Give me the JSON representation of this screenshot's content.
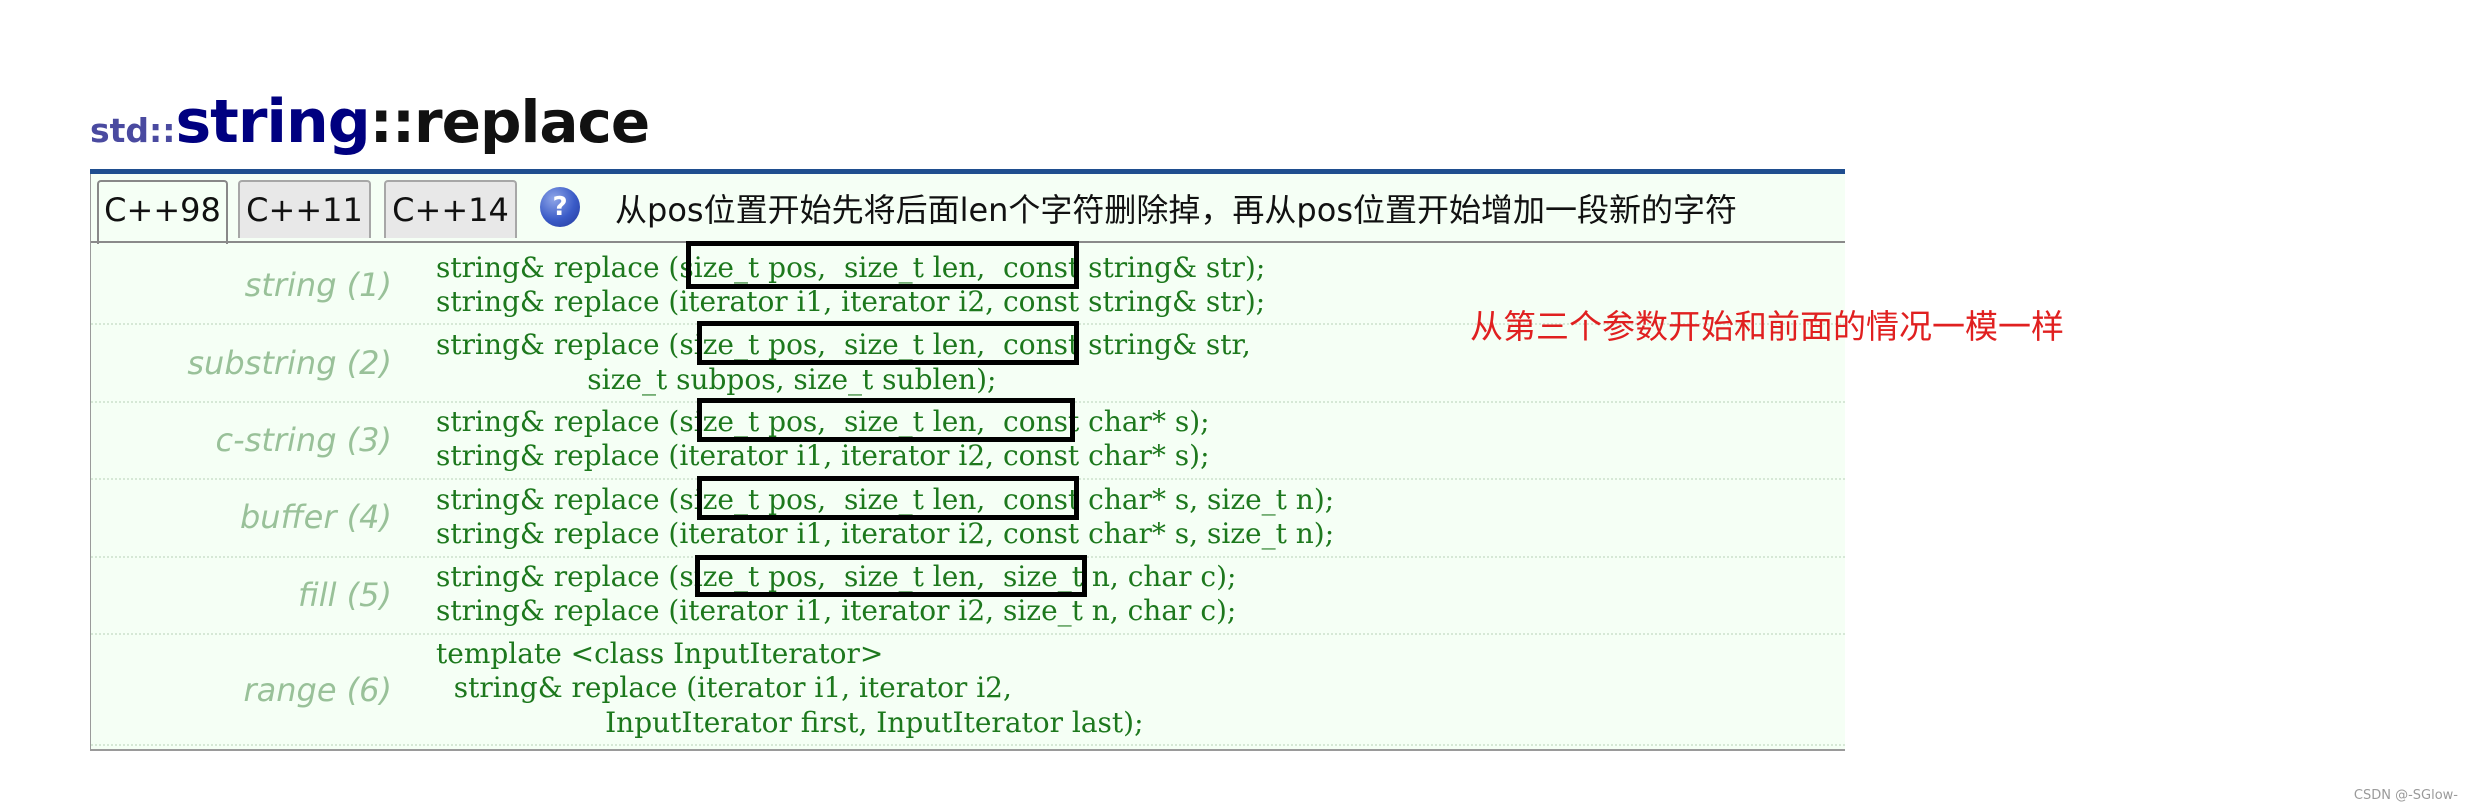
{
  "title": {
    "namespace": "std::",
    "class_name": "string",
    "function": "::replace"
  },
  "tabs": [
    {
      "label": "C++98",
      "active": true
    },
    {
      "label": "C++11",
      "active": false
    },
    {
      "label": "C++14",
      "active": false
    }
  ],
  "help_icon": {
    "name": "help-icon",
    "glyph": "?"
  },
  "annotation_top": "从pos位置开始先将后面len个字符删除掉，再从pos位置开始增加一段新的字符",
  "annotation_side": "从第三个参数开始和前面的情况一模一样",
  "rows": [
    {
      "label": "string (1)",
      "lines": [
        "string& replace (size_t pos,  size_t len,  const string& str);",
        "string& replace (iterator i1, iterator i2, const string& str);"
      ]
    },
    {
      "label": "substring (2)",
      "lines": [
        "string& replace (size_t pos,  size_t len,  const string& str,",
        "                 size_t subpos, size_t sublen);"
      ]
    },
    {
      "label": "c-string (3)",
      "lines": [
        "string& replace (size_t pos,  size_t len,  const char* s);",
        "string& replace (iterator i1, iterator i2, const char* s);"
      ]
    },
    {
      "label": "buffer (4)",
      "lines": [
        "string& replace (size_t pos,  size_t len,  const char* s, size_t n);",
        "string& replace (iterator i1, iterator i2, const char* s, size_t n);"
      ]
    },
    {
      "label": "fill (5)",
      "lines": [
        "string& replace (size_t pos,  size_t len,  size_t n, char c);",
        "string& replace (iterator i1, iterator i2, size_t n, char c);"
      ]
    },
    {
      "label": "range (6)",
      "lines": [
        "template <class InputIterator>",
        "  string& replace (iterator i1, iterator i2,",
        "                   InputIterator first, InputIterator last);"
      ]
    }
  ],
  "watermark": "CSDN @-SGlow-",
  "colors": {
    "accent_rule": "#1f4e8f",
    "code_green": "#1d781d",
    "label_green": "#99c199",
    "annotation_red": "#e02020",
    "box_bg": "#f5fff5"
  }
}
